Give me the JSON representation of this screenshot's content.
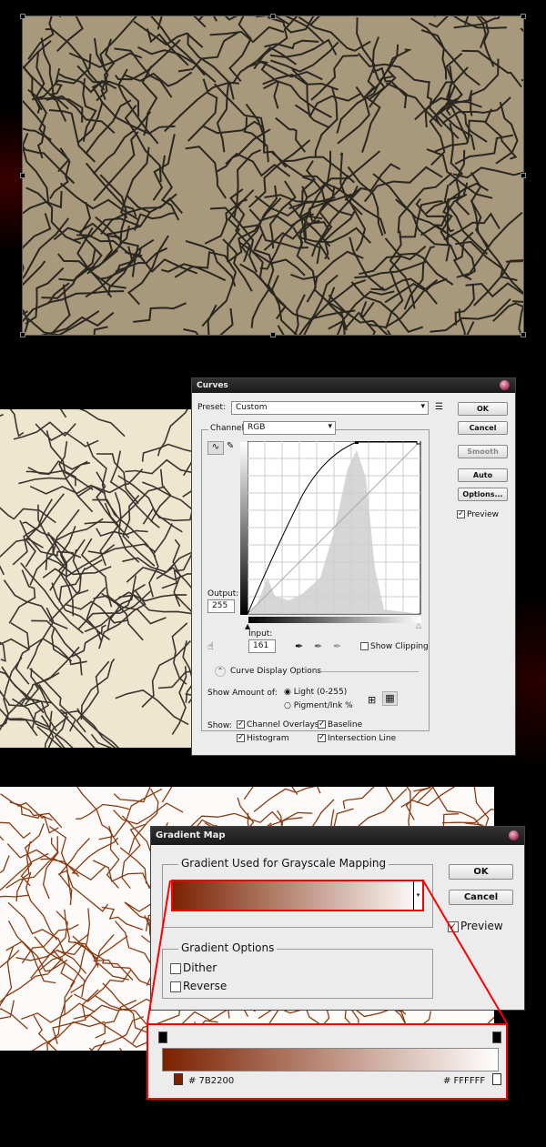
{
  "curves": {
    "title": "Curves",
    "preset_label": "Preset:",
    "preset_value": "Custom",
    "channel_label": "Channel:",
    "channel_value": "RGB",
    "buttons": {
      "ok": "OK",
      "cancel": "Cancel",
      "smooth": "Smooth",
      "auto": "Auto",
      "options": "Options..."
    },
    "preview_label": "Preview",
    "preview_checked": true,
    "output_label": "Output:",
    "output_value": "255",
    "input_label": "Input:",
    "input_value": "161",
    "show_clipping_label": "Show Clipping",
    "show_clipping_checked": false,
    "display_options_label": "Curve Display Options",
    "show_amount_label": "Show Amount of:",
    "light_option": "Light  (0-255)",
    "pigment_option": "Pigment/Ink %",
    "selected_amount": "light",
    "show_label": "Show:",
    "show_options": [
      {
        "label": "Channel Overlays",
        "checked": true
      },
      {
        "label": "Baseline",
        "checked": true
      },
      {
        "label": "Histogram",
        "checked": true
      },
      {
        "label": "Intersection Line",
        "checked": true
      }
    ]
  },
  "gradient_map": {
    "title": "Gradient Map",
    "group_label": "Gradient Used for Grayscale Mapping",
    "options_label": "Gradient Options",
    "dither_label": "Dither",
    "dither_checked": false,
    "reverse_label": "Reverse",
    "reverse_checked": false,
    "ok": "OK",
    "cancel": "Cancel",
    "preview_label": "Preview",
    "preview_checked": true,
    "start_color": "#7B2200",
    "end_color": "#FFFFFF",
    "start_color_label": "# 7B2200",
    "end_color_label": "# FFFFFF",
    "highlight_color": "#FF0000"
  }
}
